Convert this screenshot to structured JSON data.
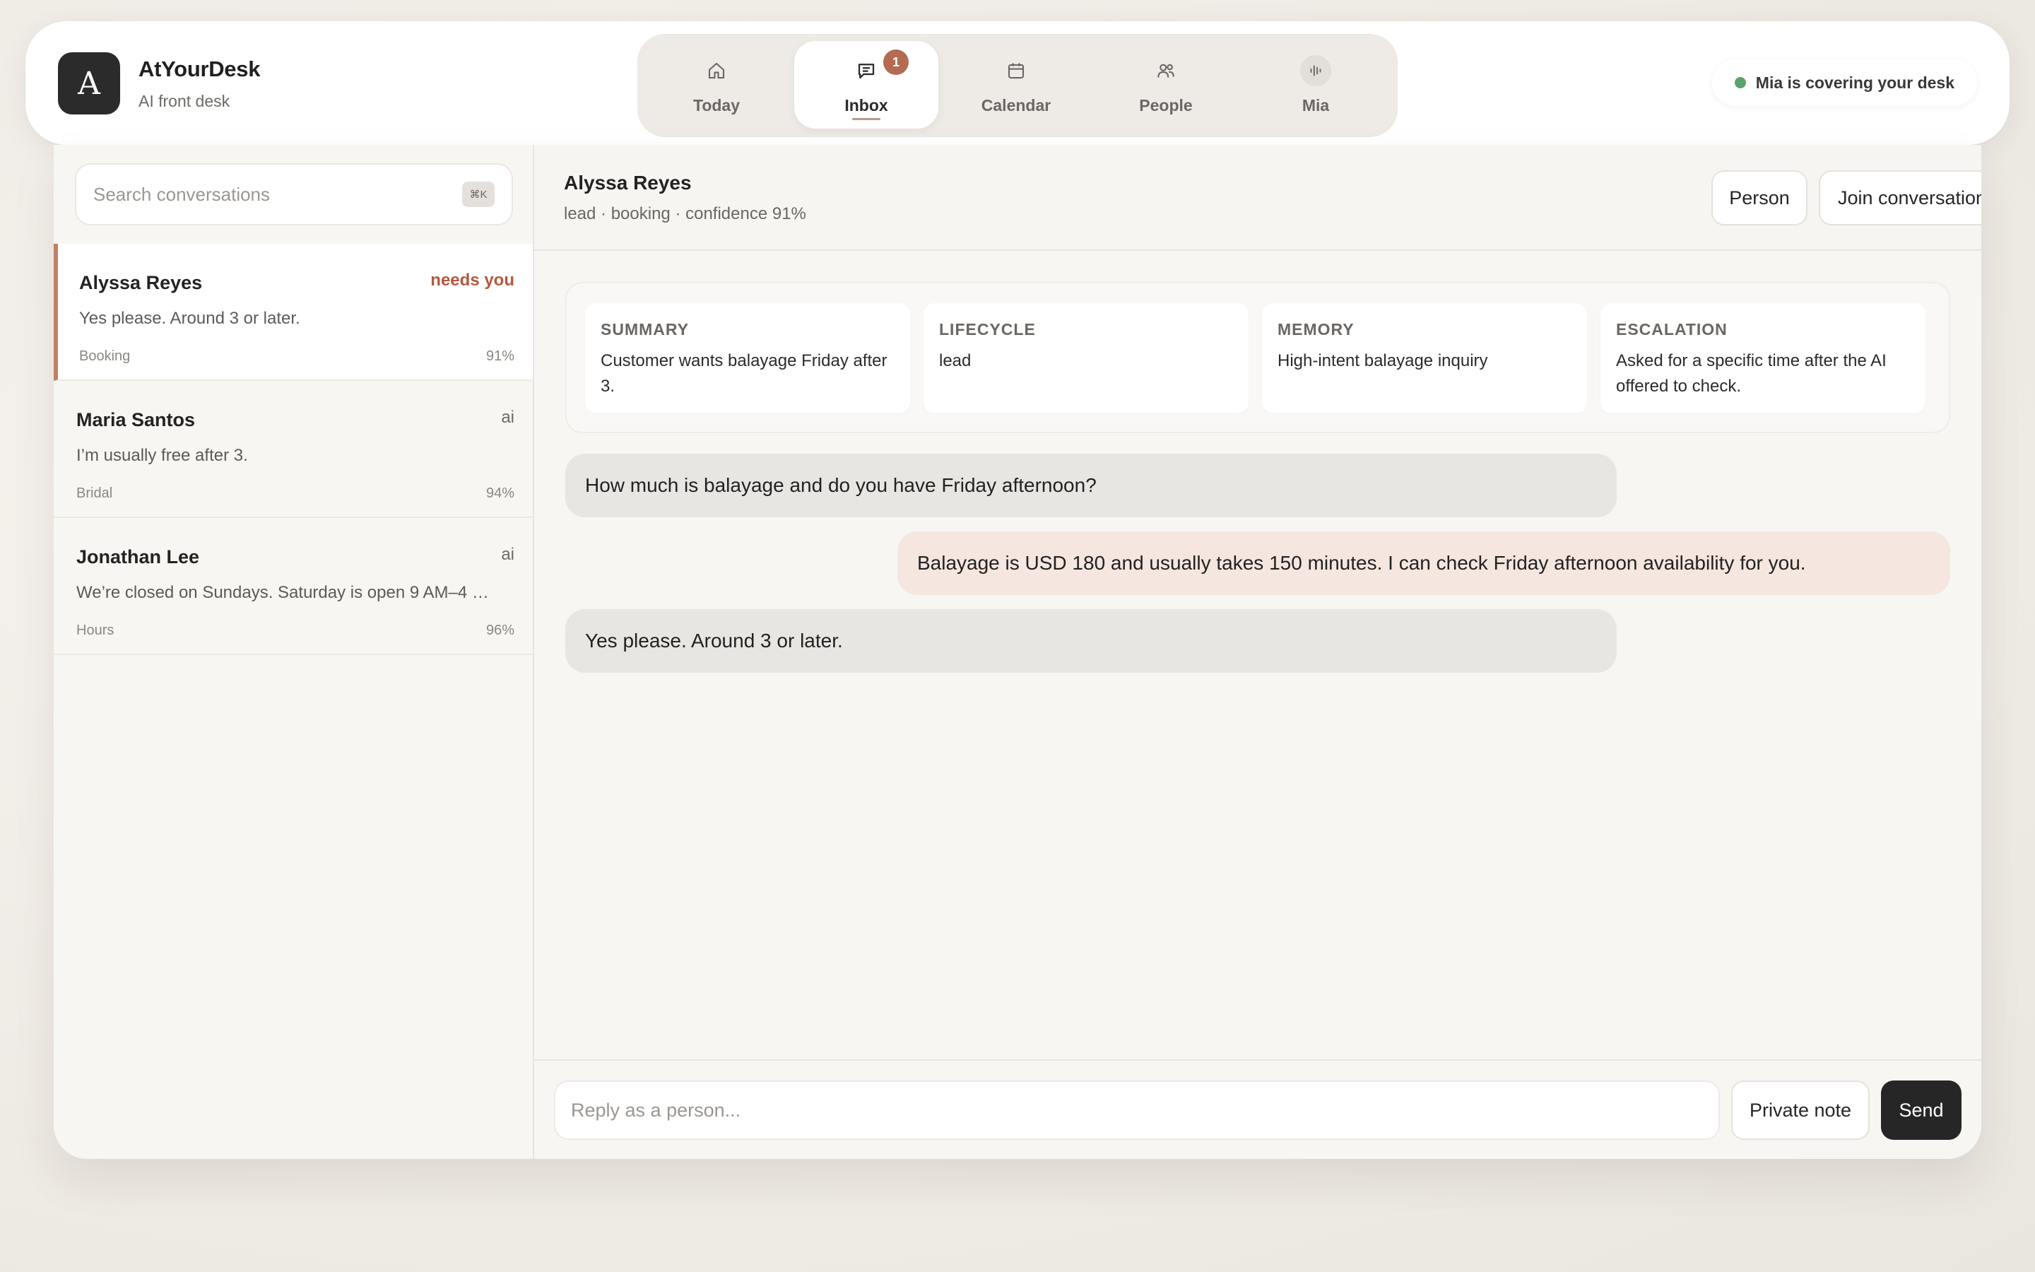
{
  "brand": {
    "logo_letter": "A",
    "name": "AtYourDesk",
    "subtitle": "AI front desk"
  },
  "nav": {
    "items": [
      {
        "label": "Today",
        "icon": "home-icon"
      },
      {
        "label": "Inbox",
        "icon": "message-icon",
        "badge": "1",
        "active": true
      },
      {
        "label": "Calendar",
        "icon": "calendar-icon"
      },
      {
        "label": "People",
        "icon": "people-icon"
      },
      {
        "label": "Mia",
        "icon": "voice-wave-icon"
      }
    ]
  },
  "status": {
    "text": "Mia is covering your desk",
    "color": "#5aa36f"
  },
  "search": {
    "placeholder": "Search conversations",
    "shortcut": "⌘K"
  },
  "conversations": [
    {
      "name": "Alyssa Reyes",
      "tag": "needs you",
      "preview": "Yes please. Around 3 or later.",
      "category": "Booking",
      "confidence": "91%",
      "selected": true
    },
    {
      "name": "Maria Santos",
      "tag": "ai",
      "preview": "I’m usually free after 3.",
      "category": "Bridal",
      "confidence": "94%"
    },
    {
      "name": "Jonathan Lee",
      "tag": "ai",
      "preview": "We’re closed on Sundays. Saturday is open 9 AM–4 …",
      "category": "Hours",
      "confidence": "96%"
    }
  ],
  "thread": {
    "name": "Alyssa Reyes",
    "meta": "lead · booking · confidence 91%",
    "actions": {
      "person": "Person",
      "join": "Join conversation"
    },
    "cards": [
      {
        "title": "SUMMARY",
        "body": "Customer wants balayage Friday after 3."
      },
      {
        "title": "LIFECYCLE",
        "body": "lead"
      },
      {
        "title": "MEMORY",
        "body": "High-intent balayage inquiry"
      },
      {
        "title": "ESCALATION",
        "body": "Asked for a specific time after the AI offered to check."
      }
    ],
    "messages": [
      {
        "direction": "in",
        "text": "How much is balayage and do you have Friday afternoon?"
      },
      {
        "direction": "out",
        "text": "Balayage is USD 180 and usually takes 150 minutes. I can check Friday afternoon availability for you."
      },
      {
        "direction": "in",
        "text": "Yes please. Around 3 or later."
      }
    ]
  },
  "composer": {
    "placeholder": "Reply as a person...",
    "private_note": "Private note",
    "send": "Send"
  },
  "colors": {
    "accent": "#c08064",
    "alert": "#b5583f",
    "badge": "#b36b52",
    "outgoing_bubble": "#f5e6df"
  }
}
